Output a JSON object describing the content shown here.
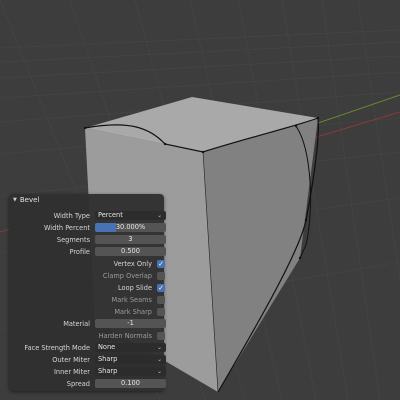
{
  "operator_panel": {
    "title": "Bevel",
    "fields": {
      "width_type": {
        "label": "Width Type",
        "value": "Percent"
      },
      "width_percent": {
        "label": "Width Percent",
        "value": "30.000%",
        "fill_fraction": 0.3
      },
      "segments": {
        "label": "Segments",
        "value": "3"
      },
      "profile": {
        "label": "Profile",
        "value": "0.500"
      },
      "vertex_only": {
        "label": "Vertex Only",
        "checked": true
      },
      "clamp_overlap": {
        "label": "Clamp Overlap",
        "checked": false
      },
      "loop_slide": {
        "label": "Loop Slide",
        "checked": true
      },
      "mark_seams": {
        "label": "Mark Seams",
        "checked": false
      },
      "mark_sharp": {
        "label": "Mark Sharp",
        "checked": false
      },
      "material": {
        "label": "Material",
        "value": "-1"
      },
      "harden_normals": {
        "label": "Harden Normals",
        "checked": false
      },
      "face_strength_mode": {
        "label": "Face Strength Mode",
        "value": "None"
      },
      "outer_miter": {
        "label": "Outer Miter",
        "value": "Sharp"
      },
      "inner_miter": {
        "label": "Inner Miter",
        "value": "Sharp"
      },
      "spread": {
        "label": "Spread",
        "value": "0.100"
      }
    }
  },
  "icons": {
    "collapse": "triangle-down-icon",
    "dropdown": "chevron-down-icon",
    "check": "checkmark-icon"
  },
  "colors": {
    "viewport_bg": "#3d3d3d",
    "panel_bg": "#303030",
    "field_bg": "#545454",
    "dropdown_bg": "#2c2c2c",
    "accent": "#4772b3",
    "x_axis": "#8a3b3b",
    "y_axis": "#6b8a2f"
  }
}
